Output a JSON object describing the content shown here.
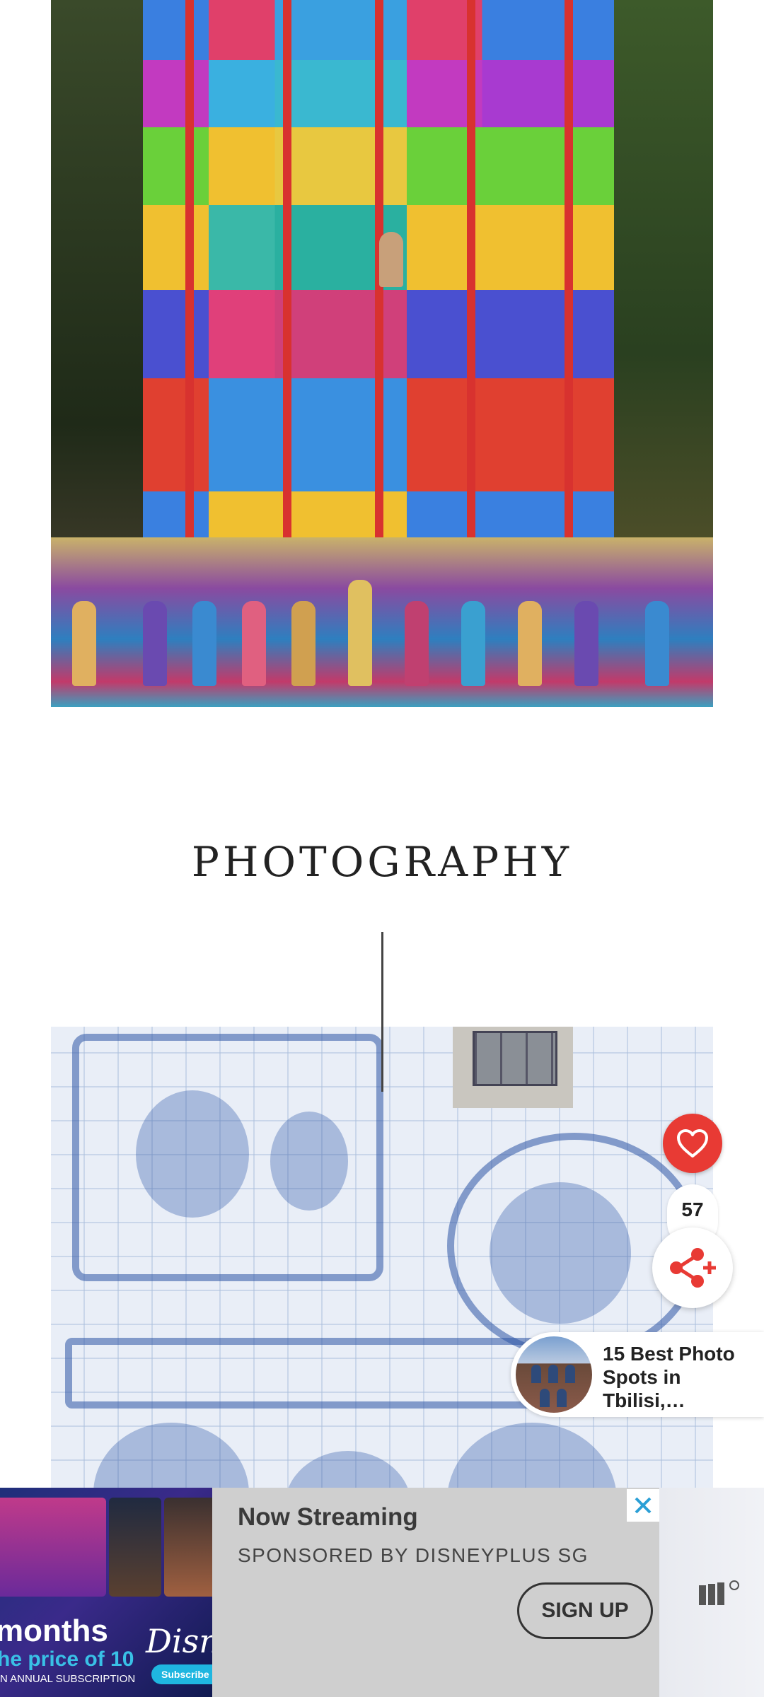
{
  "section": {
    "title": "PHOTOGRAPHY"
  },
  "reactions": {
    "like_count": "57"
  },
  "related_article": {
    "title": "15 Best Photo Spots in Tbilisi,…"
  },
  "ad": {
    "headline": "Now Streaming",
    "sponsor": "SPONSORED BY DISNEYPLUS SG",
    "cta": "SIGN UP",
    "creative": {
      "months_text": "months",
      "price_text": "he price of 10",
      "annual_text": "N ANNUAL SUBSCRIPTION",
      "brand_text": "Disne",
      "subscribe_text": "Subscribe N"
    }
  },
  "colors": {
    "accent_red": "#e83a34",
    "ad_background": "#cfcfcf"
  },
  "icons": {
    "like": "heart-icon",
    "share": "share-icon",
    "close": "close-icon",
    "ad_logo": "ad-network-logo-icon"
  }
}
